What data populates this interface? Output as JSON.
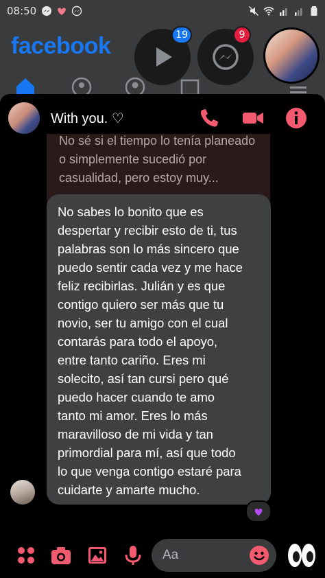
{
  "status_bar": {
    "time": "08:50",
    "left_icons": [
      "messenger-icon",
      "heart-icon",
      "messenger-icon"
    ],
    "right_icons": [
      "mute-icon",
      "wifi-icon",
      "signal-icon",
      "signal-icon",
      "battery-icon"
    ]
  },
  "facebook": {
    "logo": "facebook",
    "watch_badge": "19",
    "messenger_badge": "9"
  },
  "chat": {
    "title": "With you. ♡",
    "previous_message": "No sé si el tiempo lo tenía planeado o simplemente sucedió por casualidad, pero estoy muy...",
    "message": "No sabes lo bonito que es\ndespertar y recibir esto de ti, tus\npalabras son lo más sincero que\npuedo sentir cada vez y me hace\nfeliz recibirlas. Julián y es que\ncontigo quiero ser más que tu\nnovio, ser tu amigo con el cual\ncontarás para todo el apoyo,\nentre tanto cariño. Eres mi\nsolecito, así tan cursi pero qué\npuedo hacer cuando te amo\ntanto mi amor. Eres lo más\nmaravilloso de mi vida y tan\nprimordial para mí, así que todo\nlo que venga contigo estaré para\ncuidarte y amarte mucho.",
    "reaction": "purple-heart"
  },
  "composer": {
    "placeholder": "Aa",
    "quick_reaction": "eyes-emoji"
  },
  "colors": {
    "accent": "#f3596f",
    "facebook_blue": "#1877f2",
    "bubble_gray": "#3e4042",
    "badge_blue": "#1877f2",
    "badge_red": "#e41e3f",
    "reaction_purple": "#b44cf0"
  }
}
